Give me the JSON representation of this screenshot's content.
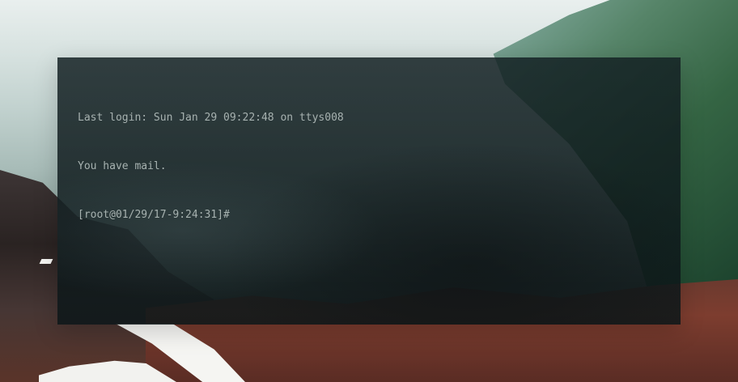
{
  "terminal": {
    "lines": [
      "Last login: Sun Jan 29 09:22:48 on ttys008",
      "You have mail.",
      "[root@01/29/17-9:24:31]#"
    ]
  }
}
